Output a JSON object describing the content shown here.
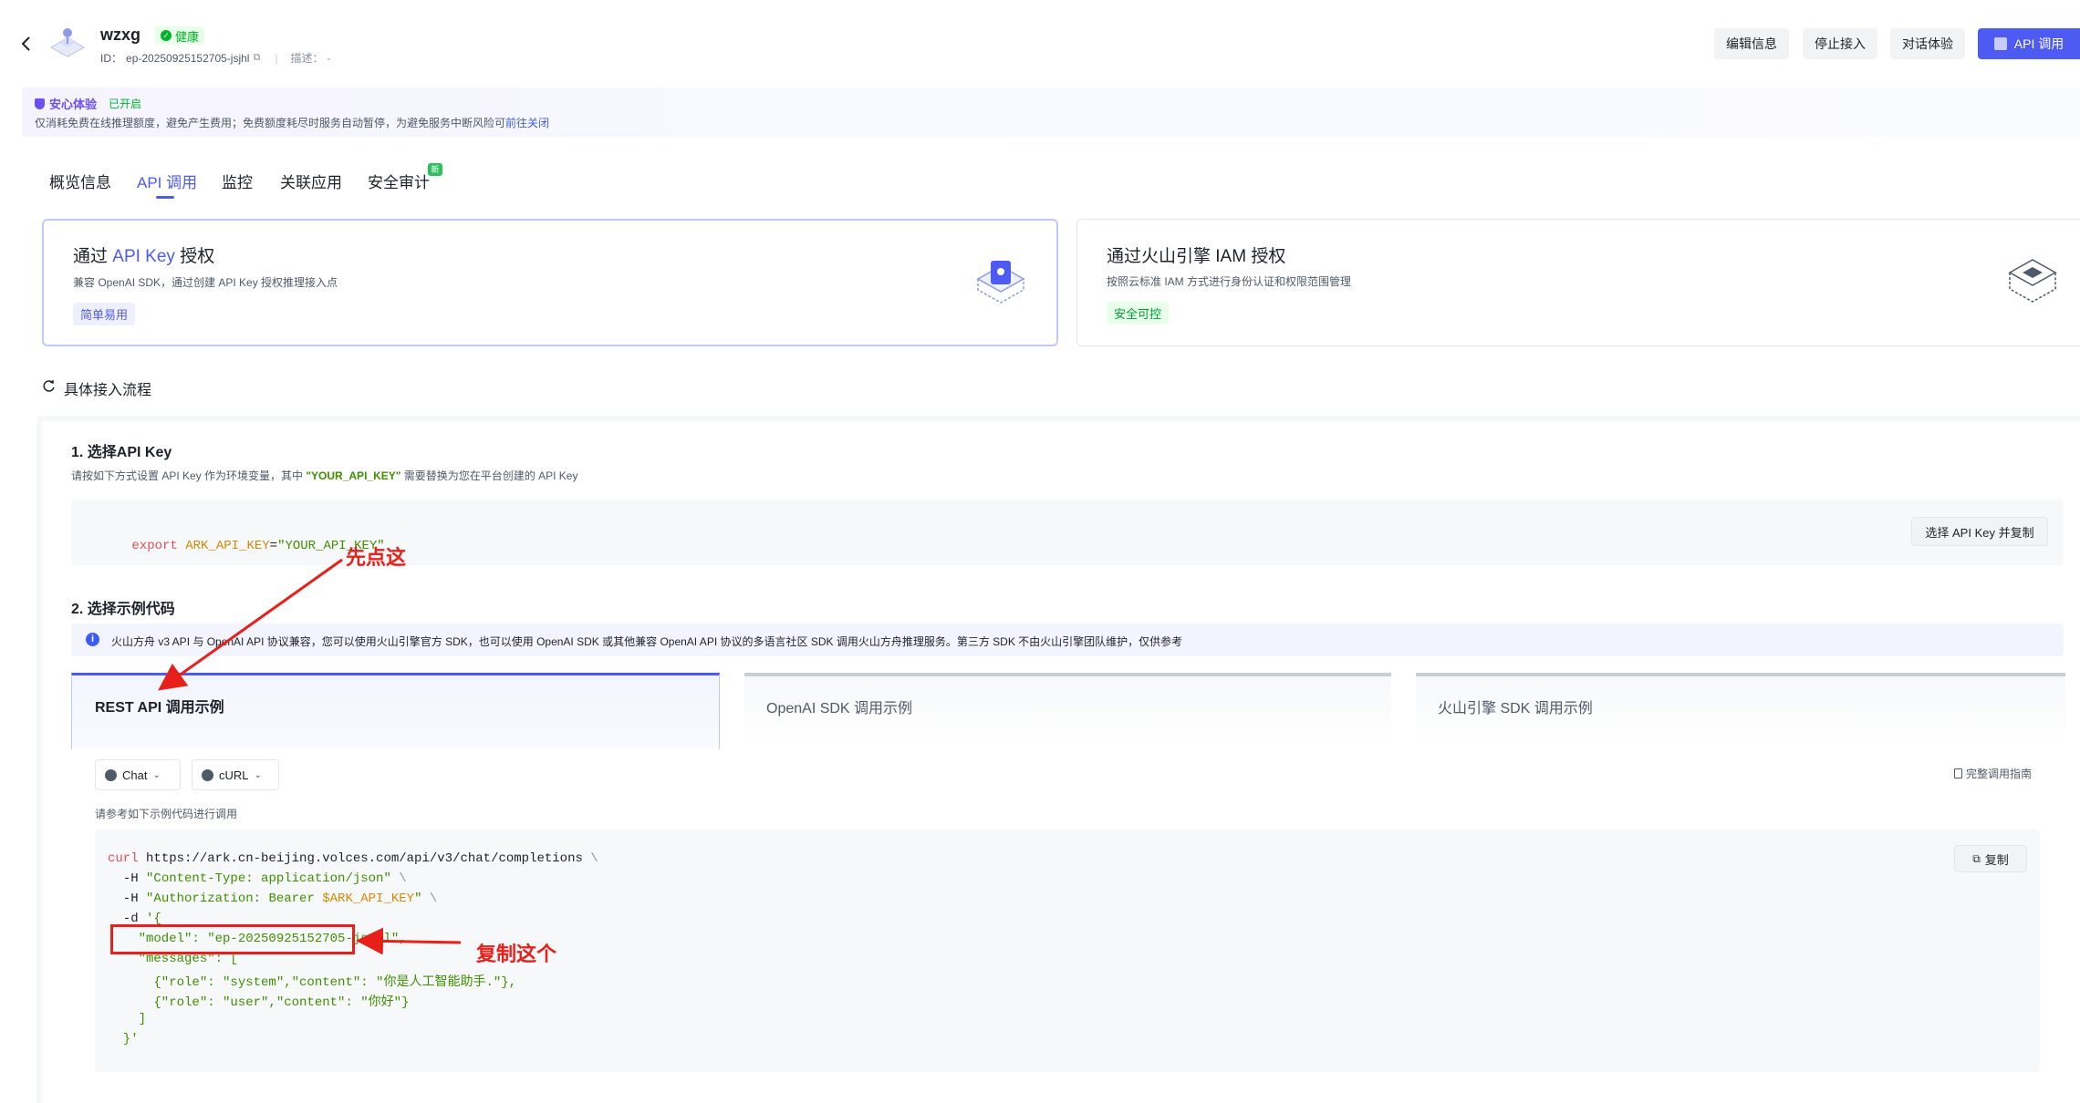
{
  "header": {
    "name": "wzxg",
    "health": "健康",
    "id_label": "ID：",
    "id_value": "ep-20250925152705-jsjhl",
    "desc_label": "描述：",
    "desc_value": "-",
    "buttons": {
      "edit": "编辑信息",
      "stop": "停止接入",
      "chat": "对话体验",
      "api": "API 调用"
    }
  },
  "notice": {
    "title": "安心体验",
    "status": "已开启",
    "text": "仅消耗免费在线推理额度，避免产生费用；免费额度耗尽时服务自动暂停，为避免服务中断风险可",
    "link": "前往关闭"
  },
  "tabs": [
    {
      "label": "概览信息"
    },
    {
      "label": "API 调用"
    },
    {
      "label": "监控"
    },
    {
      "label": "关联应用"
    },
    {
      "label": "安全审计"
    }
  ],
  "tab_new_badge": "新",
  "auth_cards": {
    "apikey": {
      "title_prefix": "通过 ",
      "title_highlight": "API Key",
      "title_suffix": " 授权",
      "desc": "兼容 OpenAI SDK，通过创建 API Key 授权推理接入点",
      "tag": "简单易用"
    },
    "iam": {
      "title": "通过火山引擎 IAM 授权",
      "desc": "按照云标准 IAM 方式进行身份认证和权限范围管理",
      "tag": "安全可控"
    }
  },
  "flow": {
    "title": "具体接入流程",
    "step1": {
      "title": "1. 选择API Key",
      "desc_prefix": "请按如下方式设置 API Key 作为环境变量，其中 ",
      "desc_key": "\"YOUR_API_KEY\"",
      "desc_suffix": " 需要替换为您在平台创建的 API Key",
      "code_export": "export ",
      "code_var": "ARK_API_KEY",
      "code_eq": "=",
      "code_val": "\"YOUR_API_KEY\"",
      "button": "选择 API Key 并复制"
    },
    "step2": {
      "title": "2. 选择示例代码",
      "info": "火山方舟 v3 API 与 OpenAI API 协议兼容，您可以使用火山引擎官方 SDK，也可以使用 OpenAI SDK 或其他兼容 OpenAI API 协议的多语言社区 SDK 调用火山方舟推理服务。第三方 SDK 不由火山引擎团队维护，仅供参考",
      "tabs": [
        "REST API 调用示例",
        "OpenAI SDK 调用示例",
        "火山引擎 SDK 调用示例"
      ],
      "select_mode": "Chat",
      "select_lang": "cURL",
      "guide_link": "完整调用指南",
      "hint": "请参考如下示例代码进行调用",
      "copy": "复制"
    }
  },
  "code": {
    "l1_cmd": "curl",
    "l1_url": " https://ark.cn-beijing.volces.com/api/v3/chat/completions",
    "l1_bs": " \\",
    "l2_flag": "  -H ",
    "l2_str": "\"Content-Type: application/json\"",
    "l2_bs": " \\",
    "l3_flag": "  -H ",
    "l3_str": "\"Authorization: Bearer ",
    "l3_var": "$ARK_API_KEY",
    "l3_end": "\"",
    "l3_bs": " \\",
    "l4_flag": "  -d ",
    "l4_str": "'{",
    "l5": "    \"model\": \"ep-20250925152705-jsjhl\",",
    "l6": "    \"messages\": [",
    "l7": "      {\"role\": \"system\",\"content\": \"你是人工智能助手.\"},",
    "l8": "      {\"role\": \"user\",\"content\": \"你好\"}",
    "l9": "    ]",
    "l10": "  }'"
  },
  "annotations": {
    "click_here": "先点这",
    "copy_this": "复制这个"
  },
  "colors": {
    "primary": "#4e5bf2",
    "red": "#e8201a",
    "green": "#00b42a",
    "code_red": "#e34d59",
    "code_orange": "#d48806",
    "code_green": "#3f8f00"
  }
}
